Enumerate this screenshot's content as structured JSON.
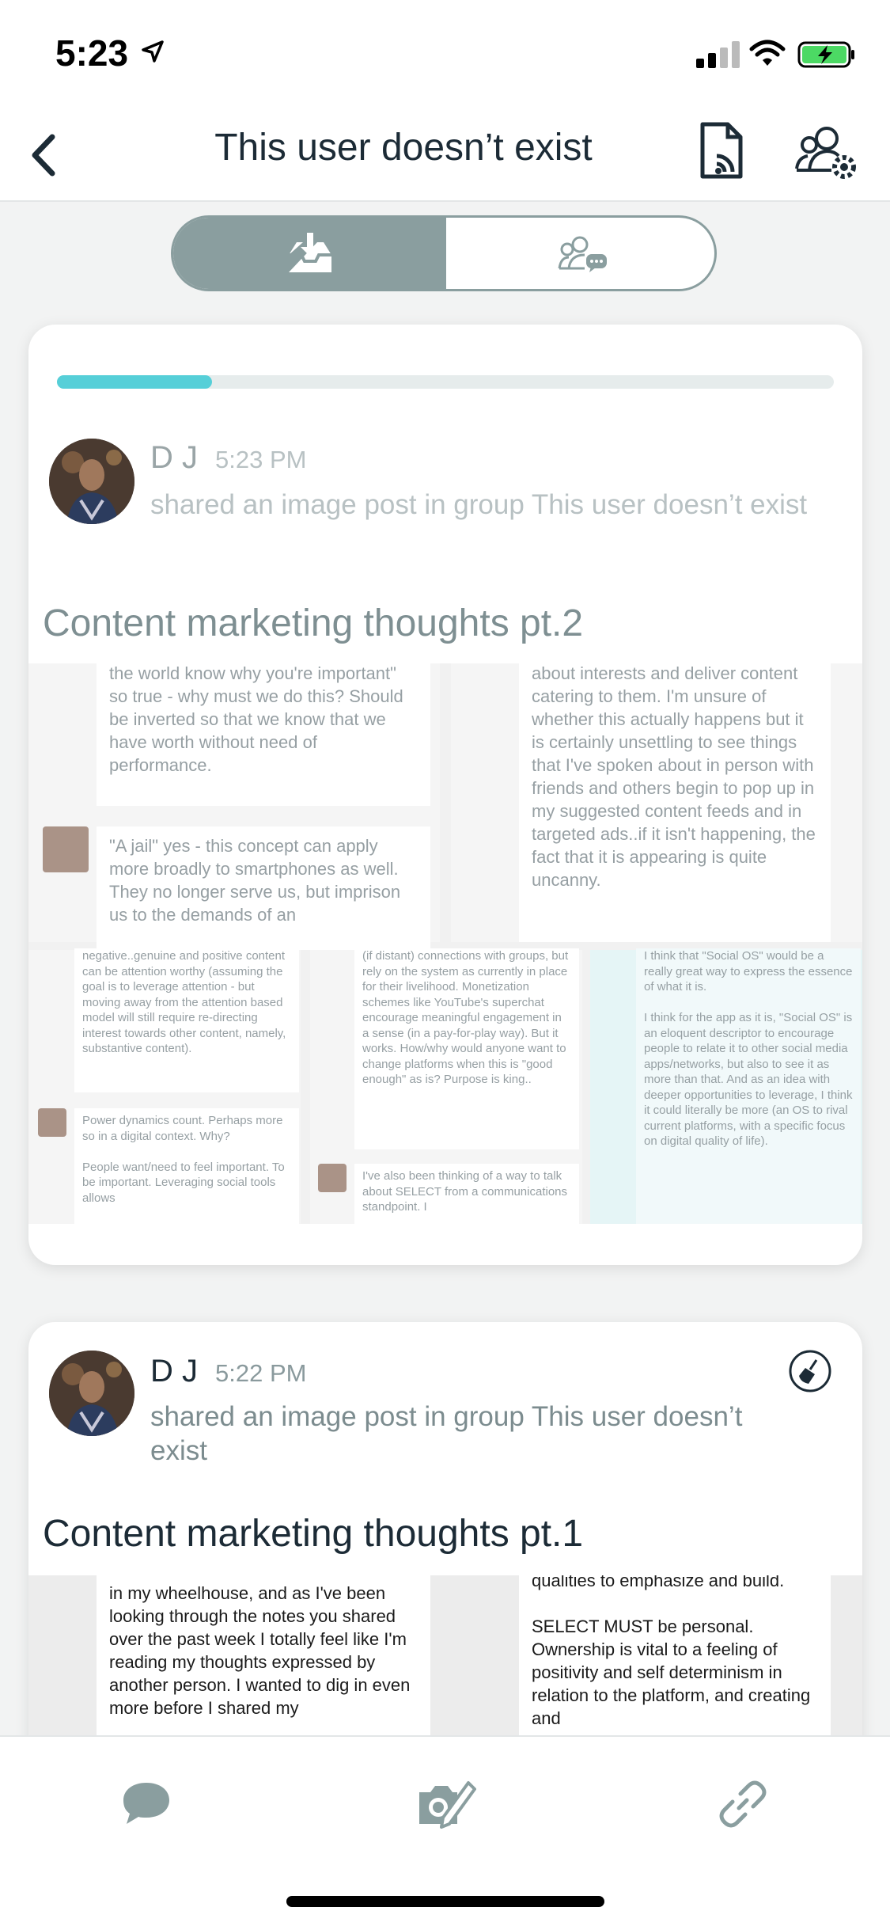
{
  "status_bar": {
    "time": "5:23"
  },
  "nav": {
    "title": "This user doesn’t exist"
  },
  "segmented": {
    "left_icon": "inbox-download-icon",
    "right_icon": "group-chat-icon",
    "selected": "left"
  },
  "posts": [
    {
      "progress": 0.2,
      "author": "D J",
      "time": "5:23 PM",
      "activity": "shared an image post in group This user doesn’t exist",
      "title": "Content marketing thoughts pt.2",
      "image_text": {
        "b1": "the world know why you're important\" so true - why must we do this? Should be inverted so that we know that we have worth without need of performance.",
        "b2": "\"A jail\" yes - this concept can apply more broadly to smartphones as well. They no longer serve us, but imprison us to the demands of an",
        "b3": "about interests and deliver content catering to them. I'm unsure of whether this actually happens but it is certainly unsettling to see things that I've spoken about in person with friends and others begin to pop up in my suggested content feeds and in targeted ads..if it isn't happening, the fact that it is appearing is quite uncanny.",
        "s1": "negative..genuine and positive content can be attention worthy (assuming the goal is to leverage attention - but moving away from the attention based model will still require re-directing interest towards other content, namely, substantive content).",
        "s2": "Power dynamics count. Perhaps more so in a digital context. Why?\n\nPeople want/need to feel important. To be important. Leveraging social tools allows",
        "s3": "(if distant) connections with groups, but rely on the system as currently in place for their livelihood. Monetization schemes like YouTube's superchat encourage meaningful engagement in a sense (in a pay-for-play way). But it works. How/why would anyone want to change platforms when this is \"good enough\" as is? Purpose is king..",
        "s4": "I've also been thinking of a way to talk about SELECT from a communications standpoint. I",
        "s5": "I think that \"Social OS\" would be a really great way to express the essence of what it is.\n\nI think for the app as it is, \"Social OS\" is an eloquent descriptor to encourage people to relate it to other social media apps/networks, but also to see it as more than that. And as an idea with deeper opportunities to leverage, I think it could literally be more (an OS to rival current platforms, with a specific focus on digital quality of life)."
      }
    },
    {
      "author": "D J",
      "time": "5:22 PM",
      "activity": "shared an image post in group This user doesn’t exist",
      "title": "Content marketing thoughts pt.1",
      "image_text": {
        "b1": "in my wheelhouse, and as I've been looking through the notes you shared over the past week I totally feel like I'm reading my thoughts expressed by another person. I wanted to dig in even more before I shared my",
        "b2": "qualities to emphasize and build.\n\nSELECT MUST be personal. Ownership is vital to a feeling of positivity and self determinism in relation to the platform, and creating and"
      }
    }
  ],
  "tabbar": {
    "items": [
      "chat-bubble-icon",
      "camera-edit-icon",
      "link-icon"
    ]
  }
}
